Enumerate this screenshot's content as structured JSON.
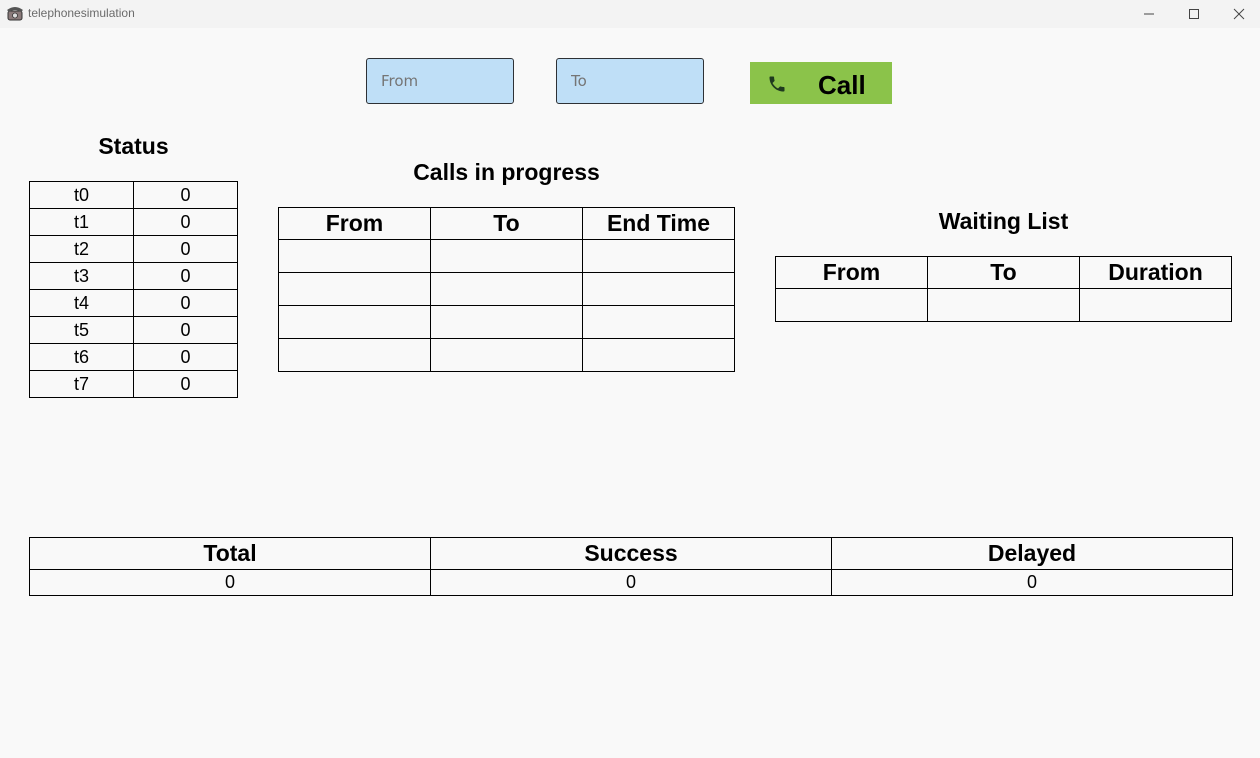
{
  "window": {
    "title": "telephonesimulation"
  },
  "controls": {
    "from_placeholder": "From",
    "to_placeholder": "To",
    "call_label": "Call",
    "call_color": "#8bc34a",
    "field_color": "#bfdff7"
  },
  "status": {
    "title": "Status",
    "rows": [
      {
        "line": "t0",
        "value": "0"
      },
      {
        "line": "t1",
        "value": "0"
      },
      {
        "line": "t2",
        "value": "0"
      },
      {
        "line": "t3",
        "value": "0"
      },
      {
        "line": "t4",
        "value": "0"
      },
      {
        "line": "t5",
        "value": "0"
      },
      {
        "line": "t6",
        "value": "0"
      },
      {
        "line": "t7",
        "value": "0"
      }
    ]
  },
  "calls_in_progress": {
    "title": "Calls in progress",
    "headers": [
      "From",
      "To",
      "End Time"
    ],
    "rows": [
      [
        "",
        "",
        ""
      ],
      [
        "",
        "",
        ""
      ],
      [
        "",
        "",
        ""
      ],
      [
        "",
        "",
        ""
      ]
    ]
  },
  "waiting_list": {
    "title": "Waiting List",
    "headers": [
      "From",
      "To",
      "Duration"
    ],
    "rows": [
      [
        "",
        "",
        ""
      ]
    ]
  },
  "totals": {
    "headers": [
      "Total",
      "Success",
      "Delayed"
    ],
    "values": [
      "0",
      "0",
      "0"
    ]
  }
}
